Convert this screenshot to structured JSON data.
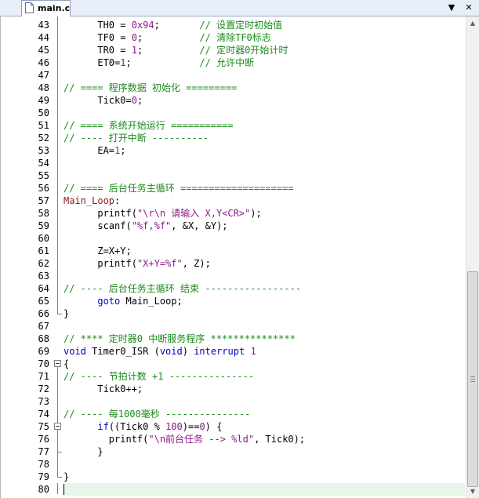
{
  "tab": {
    "title": "main.c"
  },
  "controls": {
    "down": "▼",
    "close": "✕"
  },
  "scrollbar": {
    "up": "▲",
    "down": "▼"
  },
  "lines": [
    {
      "n": "43",
      "parts": [
        [
          "",
          "      TH0 = "
        ],
        [
          "c-number",
          "0x94"
        ],
        [
          "",
          ";       "
        ],
        [
          "c-comment",
          "// 设置定时初始值"
        ]
      ]
    },
    {
      "n": "44",
      "parts": [
        [
          "",
          "      TF0 = "
        ],
        [
          "c-number",
          "0"
        ],
        [
          "",
          ";          "
        ],
        [
          "c-comment",
          "// 清除TF0标志"
        ]
      ]
    },
    {
      "n": "45",
      "parts": [
        [
          "",
          "      TR0 = "
        ],
        [
          "c-number",
          "1"
        ],
        [
          "",
          ";          "
        ],
        [
          "c-comment",
          "// 定时器0开始计时"
        ]
      ]
    },
    {
      "n": "46",
      "parts": [
        [
          "",
          "      ET0="
        ],
        [
          "c-number",
          "1"
        ],
        [
          "",
          ";            "
        ],
        [
          "c-comment",
          "// 允许中断"
        ]
      ]
    },
    {
      "n": "47",
      "parts": []
    },
    {
      "n": "48",
      "parts": [
        [
          "c-comment",
          "// ==== 程序数据 初始化 ========="
        ]
      ]
    },
    {
      "n": "49",
      "parts": [
        [
          "",
          "      Tick0="
        ],
        [
          "c-number",
          "0"
        ],
        [
          "",
          ";"
        ]
      ]
    },
    {
      "n": "50",
      "parts": []
    },
    {
      "n": "51",
      "parts": [
        [
          "c-comment",
          "// ==== 系统开始运行 ==========="
        ]
      ]
    },
    {
      "n": "52",
      "parts": [
        [
          "c-comment",
          "// ---- 打开中断 ----------"
        ]
      ]
    },
    {
      "n": "53",
      "parts": [
        [
          "",
          "      EA="
        ],
        [
          "c-number",
          "1"
        ],
        [
          "",
          ";"
        ]
      ]
    },
    {
      "n": "54",
      "parts": []
    },
    {
      "n": "55",
      "parts": []
    },
    {
      "n": "56",
      "parts": [
        [
          "c-comment",
          "// ==== 后台任务主循环 ===================="
        ]
      ]
    },
    {
      "n": "57",
      "parts": [
        [
          "c-label",
          "Main_Loop"
        ],
        [
          "",
          ":"
        ]
      ]
    },
    {
      "n": "58",
      "parts": [
        [
          "",
          "      printf("
        ],
        [
          "c-string",
          "\"\\r\\n 请输入 X,Y<CR>\""
        ],
        [
          "",
          ");"
        ]
      ]
    },
    {
      "n": "59",
      "parts": [
        [
          "",
          "      scanf("
        ],
        [
          "c-string",
          "\"%f,%f\""
        ],
        [
          "",
          ", &X, &Y);"
        ]
      ]
    },
    {
      "n": "60",
      "parts": []
    },
    {
      "n": "61",
      "parts": [
        [
          "",
          "      Z=X+Y;"
        ]
      ]
    },
    {
      "n": "62",
      "parts": [
        [
          "",
          "      printf("
        ],
        [
          "c-string",
          "\"X+Y=%f\""
        ],
        [
          "",
          ", Z);"
        ]
      ]
    },
    {
      "n": "63",
      "parts": []
    },
    {
      "n": "64",
      "parts": [
        [
          "c-comment",
          "// ---- 后台任务主循环 结束 -----------------"
        ]
      ]
    },
    {
      "n": "65",
      "parts": [
        [
          "",
          "      "
        ],
        [
          "c-keyword",
          "goto"
        ],
        [
          "",
          " Main_Loop;"
        ]
      ]
    },
    {
      "n": "66",
      "parts": [
        [
          "",
          "}"
        ]
      ]
    },
    {
      "n": "67",
      "parts": []
    },
    {
      "n": "68",
      "parts": [
        [
          "c-comment",
          "// **** 定时器0 中断服务程序 ***************"
        ]
      ]
    },
    {
      "n": "69",
      "parts": [
        [
          "c-keyword",
          "void"
        ],
        [
          "",
          " Timer0_ISR ("
        ],
        [
          "c-keyword",
          "void"
        ],
        [
          "",
          ") "
        ],
        [
          "c-keyword",
          "interrupt"
        ],
        [
          "",
          " "
        ],
        [
          "c-number",
          "1"
        ]
      ]
    },
    {
      "n": "70",
      "parts": [
        [
          "",
          "{"
        ]
      ]
    },
    {
      "n": "71",
      "parts": [
        [
          "c-comment",
          "// ---- 节拍计数 +1 ---------------"
        ]
      ]
    },
    {
      "n": "72",
      "parts": [
        [
          "",
          "      Tick0++;"
        ]
      ]
    },
    {
      "n": "73",
      "parts": []
    },
    {
      "n": "74",
      "parts": [
        [
          "c-comment",
          "// ---- 每1000毫秒 ---------------"
        ]
      ]
    },
    {
      "n": "75",
      "parts": [
        [
          "",
          "      "
        ],
        [
          "c-keyword",
          "if"
        ],
        [
          "",
          "((Tick0 % "
        ],
        [
          "c-number",
          "100"
        ],
        [
          "",
          ")=="
        ],
        [
          "c-number",
          "0"
        ],
        [
          "",
          ") {"
        ]
      ]
    },
    {
      "n": "76",
      "parts": [
        [
          "",
          "        printf("
        ],
        [
          "c-string",
          "\"\\n前台任务 --> %ld\""
        ],
        [
          "",
          ", Tick0);"
        ]
      ]
    },
    {
      "n": "77",
      "parts": [
        [
          "",
          "      }"
        ]
      ]
    },
    {
      "n": "78",
      "parts": []
    },
    {
      "n": "79",
      "parts": [
        [
          "",
          "}"
        ]
      ]
    },
    {
      "n": "80",
      "parts": []
    }
  ]
}
